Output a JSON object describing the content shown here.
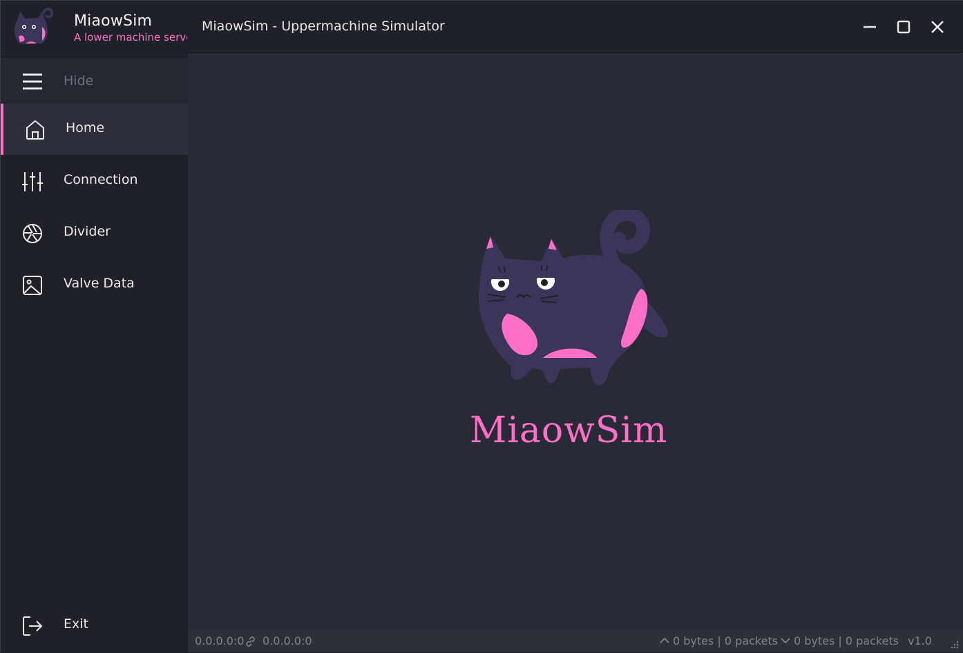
{
  "app": {
    "name": "MiaowSim",
    "tagline": "A lower machine server",
    "window_title": "MiaowSim - Uppermachine Simulator",
    "accent_color": "#ff6ec7"
  },
  "window_controls": {
    "minimize_icon": "minimize-icon",
    "maximize_icon": "maximize-icon",
    "close_icon": "close-icon"
  },
  "sidebar": {
    "hide_label": "Hide",
    "items": [
      {
        "label": "Home",
        "icon": "home-icon",
        "active": true
      },
      {
        "label": "Connection",
        "icon": "sliders-icon",
        "active": false
      },
      {
        "label": "Divider",
        "icon": "aperture-icon",
        "active": false
      },
      {
        "label": "Valve Data",
        "icon": "image-icon",
        "active": false
      }
    ],
    "exit_label": "Exit"
  },
  "main": {
    "brand": "MiaowSim"
  },
  "statusbar": {
    "local_address": "0.0.0.0:0",
    "remote_address": "0.0.0.0:0",
    "upload": "0 bytes | 0 packets",
    "download": "0 bytes | 0 packets",
    "version": "v1.0"
  }
}
